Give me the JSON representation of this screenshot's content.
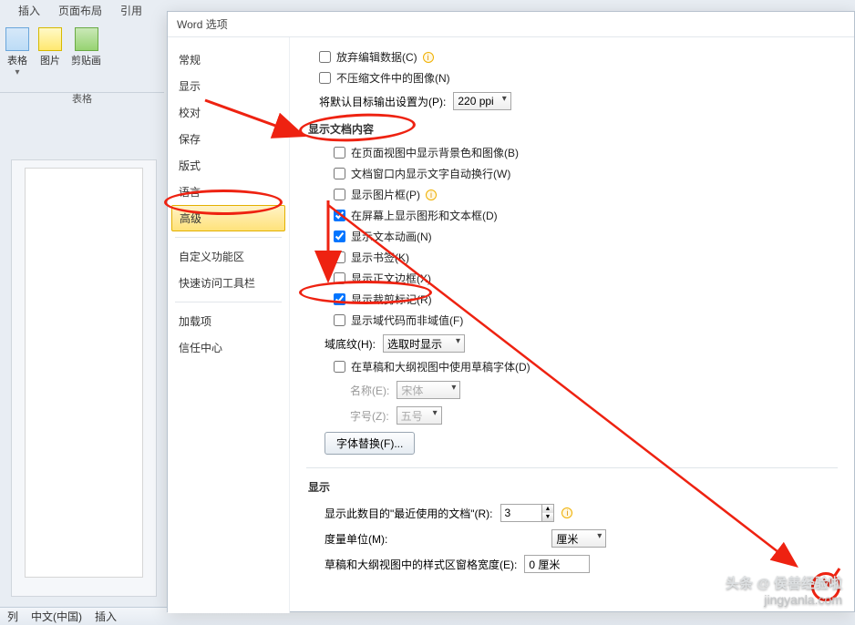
{
  "ribbon": {
    "tabs": [
      "插入",
      "页面布局",
      "引用"
    ],
    "tool_table": "表格",
    "tool_pic": "图片",
    "tool_clip": "剪贴画",
    "group_label": "表格"
  },
  "statusbar": {
    "col": "列",
    "lang": "中文(中国)",
    "mode": "插入"
  },
  "dialog": {
    "title": "Word 选项",
    "sidebar": {
      "general": "常规",
      "display": "显示",
      "proof": "校对",
      "save": "保存",
      "layout": "版式",
      "language": "语言",
      "advanced": "高级",
      "customize": "自定义功能区",
      "quickaccess": "快速访问工具栏",
      "addins": "加载项",
      "trust": "信任中心"
    }
  },
  "top": {
    "discard_edit": "放弃编辑数据(C)",
    "no_compress": "不压缩文件中的图像(N)",
    "default_out_label": "将默认目标输出设置为(P):",
    "default_out_value": "220 ppi"
  },
  "sec_doc_heading": "显示文档内容",
  "doc": {
    "bg": "在页面视图中显示背景色和图像(B)",
    "wrap": "文档窗口内显示文字自动换行(W)",
    "picframe": "显示图片框(P)",
    "screen_shapes": "在屏幕上显示图形和文本框(D)",
    "text_anim": "显示文本动画(N)",
    "bookmarks": "显示书签(K)",
    "body_border": "显示正文边框(X)",
    "crop": "显示裁剪标记(R)",
    "fieldcodes": "显示域代码而非域值(F)",
    "shade_label": "域底纹(H):",
    "shade_value": "选取时显示",
    "draft_font": "在草稿和大纲视图中使用草稿字体(D)",
    "name_label": "名称(E):",
    "name_value": "宋体",
    "size_label": "字号(Z):",
    "size_value": "五号",
    "font_sub_btn": "字体替换(F)..."
  },
  "sec_disp_heading": "显示",
  "disp": {
    "recent_label": "显示此数目的\"最近使用的文档\"(R):",
    "recent_value": "3",
    "unit_label": "度量单位(M):",
    "unit_value": "厘米",
    "style_area_label": "草稿和大纲视图中的样式区窗格宽度(E):",
    "style_area_value": "0 厘米"
  },
  "watermark": {
    "line1": "头条 @ 侯善经验啦",
    "line2": "jingyanla.com"
  }
}
